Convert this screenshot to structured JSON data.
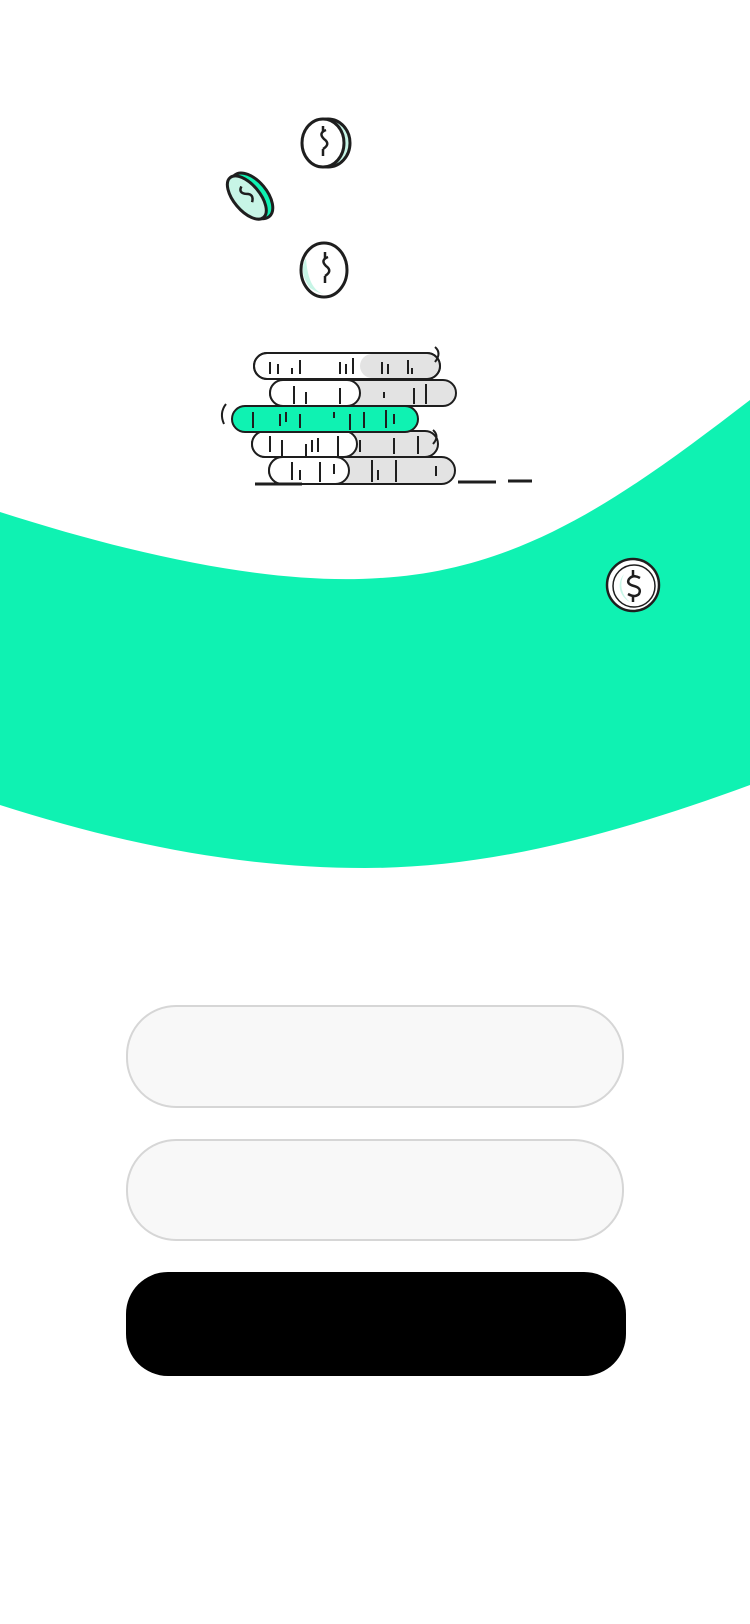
{
  "theme": {
    "accent": "#0ff2b2",
    "button_bg": "#000000",
    "field_bg": "#f8f8f8",
    "field_border": "#d6d6d6"
  },
  "hero": {
    "icons": [
      "coin-stack-icon",
      "falling-coin-icon",
      "dollar-coin-icon"
    ]
  },
  "form": {
    "field_1": {
      "value": "",
      "placeholder": ""
    },
    "field_2": {
      "value": "",
      "placeholder": ""
    },
    "submit_label": ""
  }
}
